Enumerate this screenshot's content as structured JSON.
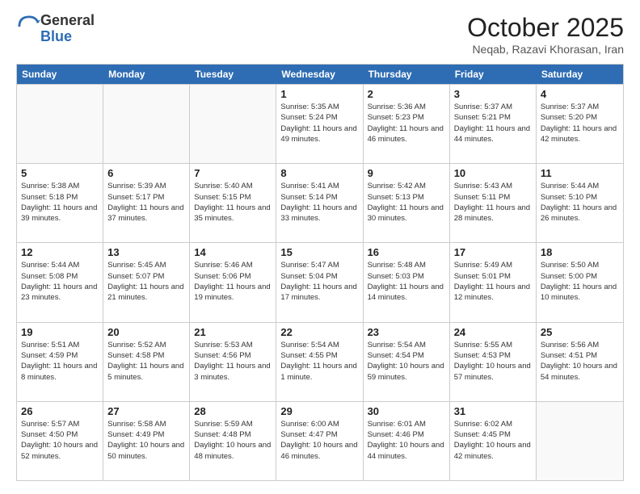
{
  "logo": {
    "general": "General",
    "blue": "Blue"
  },
  "header": {
    "month": "October 2025",
    "location": "Neqab, Razavi Khorasan, Iran"
  },
  "day_headers": [
    "Sunday",
    "Monday",
    "Tuesday",
    "Wednesday",
    "Thursday",
    "Friday",
    "Saturday"
  ],
  "weeks": [
    [
      {
        "num": "",
        "sunrise": "",
        "sunset": "",
        "daylight": ""
      },
      {
        "num": "",
        "sunrise": "",
        "sunset": "",
        "daylight": ""
      },
      {
        "num": "",
        "sunrise": "",
        "sunset": "",
        "daylight": ""
      },
      {
        "num": "1",
        "sunrise": "Sunrise: 5:35 AM",
        "sunset": "Sunset: 5:24 PM",
        "daylight": "Daylight: 11 hours and 49 minutes."
      },
      {
        "num": "2",
        "sunrise": "Sunrise: 5:36 AM",
        "sunset": "Sunset: 5:23 PM",
        "daylight": "Daylight: 11 hours and 46 minutes."
      },
      {
        "num": "3",
        "sunrise": "Sunrise: 5:37 AM",
        "sunset": "Sunset: 5:21 PM",
        "daylight": "Daylight: 11 hours and 44 minutes."
      },
      {
        "num": "4",
        "sunrise": "Sunrise: 5:37 AM",
        "sunset": "Sunset: 5:20 PM",
        "daylight": "Daylight: 11 hours and 42 minutes."
      }
    ],
    [
      {
        "num": "5",
        "sunrise": "Sunrise: 5:38 AM",
        "sunset": "Sunset: 5:18 PM",
        "daylight": "Daylight: 11 hours and 39 minutes."
      },
      {
        "num": "6",
        "sunrise": "Sunrise: 5:39 AM",
        "sunset": "Sunset: 5:17 PM",
        "daylight": "Daylight: 11 hours and 37 minutes."
      },
      {
        "num": "7",
        "sunrise": "Sunrise: 5:40 AM",
        "sunset": "Sunset: 5:15 PM",
        "daylight": "Daylight: 11 hours and 35 minutes."
      },
      {
        "num": "8",
        "sunrise": "Sunrise: 5:41 AM",
        "sunset": "Sunset: 5:14 PM",
        "daylight": "Daylight: 11 hours and 33 minutes."
      },
      {
        "num": "9",
        "sunrise": "Sunrise: 5:42 AM",
        "sunset": "Sunset: 5:13 PM",
        "daylight": "Daylight: 11 hours and 30 minutes."
      },
      {
        "num": "10",
        "sunrise": "Sunrise: 5:43 AM",
        "sunset": "Sunset: 5:11 PM",
        "daylight": "Daylight: 11 hours and 28 minutes."
      },
      {
        "num": "11",
        "sunrise": "Sunrise: 5:44 AM",
        "sunset": "Sunset: 5:10 PM",
        "daylight": "Daylight: 11 hours and 26 minutes."
      }
    ],
    [
      {
        "num": "12",
        "sunrise": "Sunrise: 5:44 AM",
        "sunset": "Sunset: 5:08 PM",
        "daylight": "Daylight: 11 hours and 23 minutes."
      },
      {
        "num": "13",
        "sunrise": "Sunrise: 5:45 AM",
        "sunset": "Sunset: 5:07 PM",
        "daylight": "Daylight: 11 hours and 21 minutes."
      },
      {
        "num": "14",
        "sunrise": "Sunrise: 5:46 AM",
        "sunset": "Sunset: 5:06 PM",
        "daylight": "Daylight: 11 hours and 19 minutes."
      },
      {
        "num": "15",
        "sunrise": "Sunrise: 5:47 AM",
        "sunset": "Sunset: 5:04 PM",
        "daylight": "Daylight: 11 hours and 17 minutes."
      },
      {
        "num": "16",
        "sunrise": "Sunrise: 5:48 AM",
        "sunset": "Sunset: 5:03 PM",
        "daylight": "Daylight: 11 hours and 14 minutes."
      },
      {
        "num": "17",
        "sunrise": "Sunrise: 5:49 AM",
        "sunset": "Sunset: 5:01 PM",
        "daylight": "Daylight: 11 hours and 12 minutes."
      },
      {
        "num": "18",
        "sunrise": "Sunrise: 5:50 AM",
        "sunset": "Sunset: 5:00 PM",
        "daylight": "Daylight: 11 hours and 10 minutes."
      }
    ],
    [
      {
        "num": "19",
        "sunrise": "Sunrise: 5:51 AM",
        "sunset": "Sunset: 4:59 PM",
        "daylight": "Daylight: 11 hours and 8 minutes."
      },
      {
        "num": "20",
        "sunrise": "Sunrise: 5:52 AM",
        "sunset": "Sunset: 4:58 PM",
        "daylight": "Daylight: 11 hours and 5 minutes."
      },
      {
        "num": "21",
        "sunrise": "Sunrise: 5:53 AM",
        "sunset": "Sunset: 4:56 PM",
        "daylight": "Daylight: 11 hours and 3 minutes."
      },
      {
        "num": "22",
        "sunrise": "Sunrise: 5:54 AM",
        "sunset": "Sunset: 4:55 PM",
        "daylight": "Daylight: 11 hours and 1 minute."
      },
      {
        "num": "23",
        "sunrise": "Sunrise: 5:54 AM",
        "sunset": "Sunset: 4:54 PM",
        "daylight": "Daylight: 10 hours and 59 minutes."
      },
      {
        "num": "24",
        "sunrise": "Sunrise: 5:55 AM",
        "sunset": "Sunset: 4:53 PM",
        "daylight": "Daylight: 10 hours and 57 minutes."
      },
      {
        "num": "25",
        "sunrise": "Sunrise: 5:56 AM",
        "sunset": "Sunset: 4:51 PM",
        "daylight": "Daylight: 10 hours and 54 minutes."
      }
    ],
    [
      {
        "num": "26",
        "sunrise": "Sunrise: 5:57 AM",
        "sunset": "Sunset: 4:50 PM",
        "daylight": "Daylight: 10 hours and 52 minutes."
      },
      {
        "num": "27",
        "sunrise": "Sunrise: 5:58 AM",
        "sunset": "Sunset: 4:49 PM",
        "daylight": "Daylight: 10 hours and 50 minutes."
      },
      {
        "num": "28",
        "sunrise": "Sunrise: 5:59 AM",
        "sunset": "Sunset: 4:48 PM",
        "daylight": "Daylight: 10 hours and 48 minutes."
      },
      {
        "num": "29",
        "sunrise": "Sunrise: 6:00 AM",
        "sunset": "Sunset: 4:47 PM",
        "daylight": "Daylight: 10 hours and 46 minutes."
      },
      {
        "num": "30",
        "sunrise": "Sunrise: 6:01 AM",
        "sunset": "Sunset: 4:46 PM",
        "daylight": "Daylight: 10 hours and 44 minutes."
      },
      {
        "num": "31",
        "sunrise": "Sunrise: 6:02 AM",
        "sunset": "Sunset: 4:45 PM",
        "daylight": "Daylight: 10 hours and 42 minutes."
      },
      {
        "num": "",
        "sunrise": "",
        "sunset": "",
        "daylight": ""
      }
    ]
  ]
}
